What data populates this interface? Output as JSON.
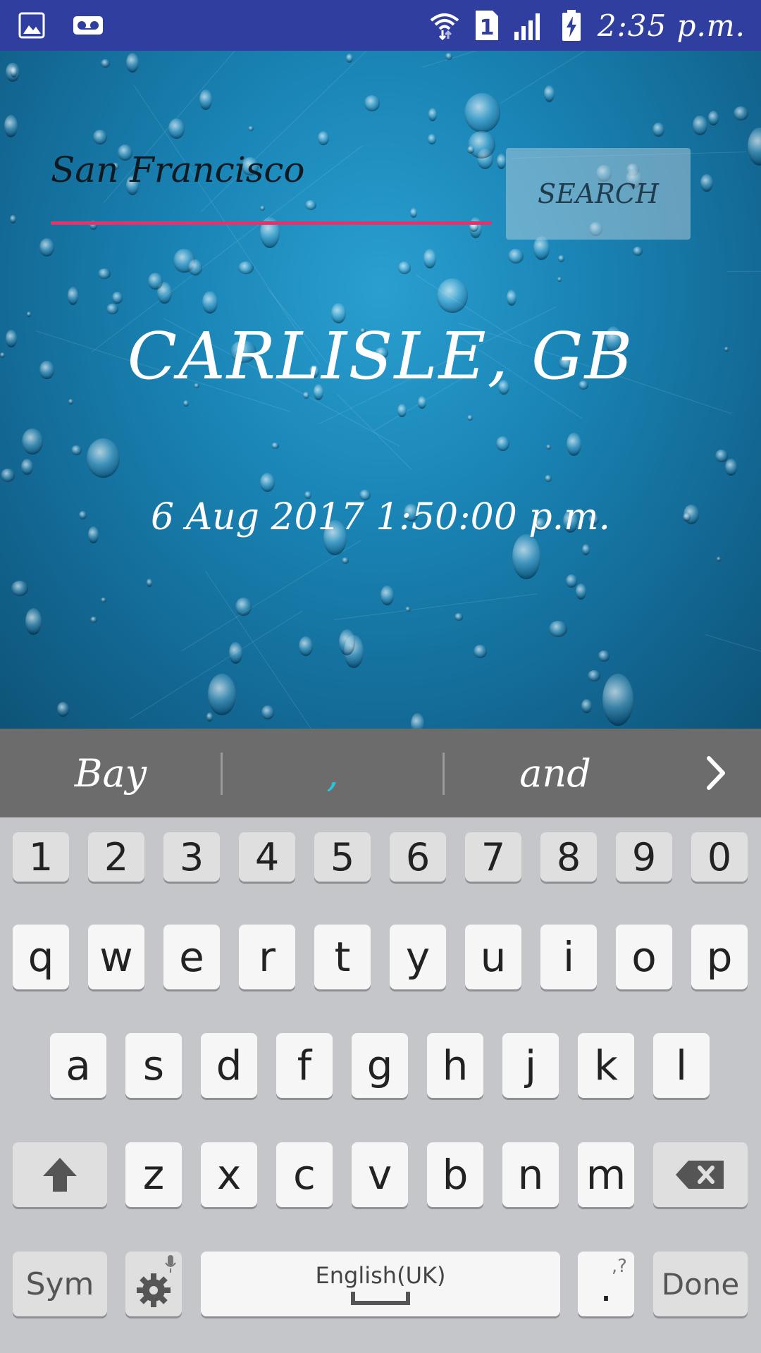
{
  "status_bar": {
    "time": "2:35 p.m.",
    "left_icons": [
      "gallery-icon",
      "voicemail-icon"
    ],
    "right_icons": [
      "wifi-icon",
      "sim-1-icon",
      "signal-icon",
      "battery-charging-icon"
    ],
    "sim_label": "1",
    "color": "#303f9f"
  },
  "search": {
    "input_value": "San Francisco",
    "button_label": "SEARCH",
    "underline_color": "#e53268"
  },
  "weather": {
    "location": "CARLISLE, GB",
    "datetime": "6 Aug 2017 1:50:00 p.m.",
    "icon": "cloud-icon"
  },
  "keyboard": {
    "suggestions": [
      "Bay",
      ",",
      "and"
    ],
    "suggestion_comma_color": "#29c4d8",
    "more_suggestions_icon": "chevron-right-icon",
    "number_row": [
      "1",
      "2",
      "3",
      "4",
      "5",
      "6",
      "7",
      "8",
      "9",
      "0"
    ],
    "row1": [
      "q",
      "w",
      "e",
      "r",
      "t",
      "y",
      "u",
      "i",
      "o",
      "p"
    ],
    "row2": [
      "a",
      "s",
      "d",
      "f",
      "g",
      "h",
      "j",
      "k",
      "l"
    ],
    "row3": [
      "z",
      "x",
      "c",
      "v",
      "b",
      "n",
      "m"
    ],
    "sym_label": "Sym",
    "space_label": "English(UK)",
    "period_label": ".",
    "period_hint": ",?",
    "done_label": "Done",
    "shift_icon": "shift-icon",
    "backspace_icon": "backspace-icon",
    "settings_icon": "settings-icon",
    "mic_icon": "mic-icon"
  }
}
